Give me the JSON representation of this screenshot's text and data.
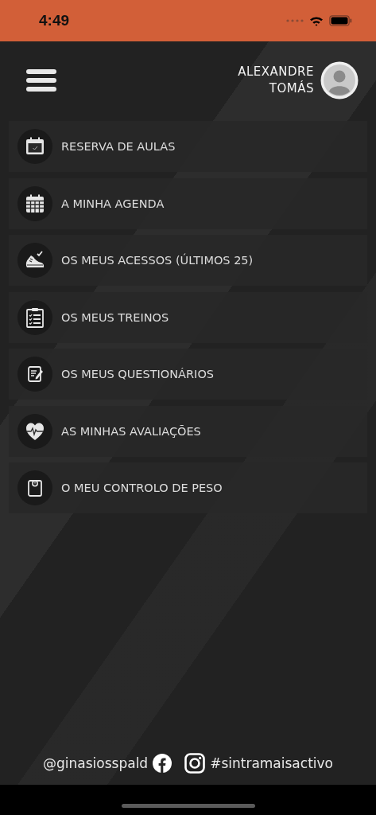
{
  "status_bar": {
    "time": "4:49"
  },
  "header": {
    "user_name": "ALEXANDRE TOMÁS"
  },
  "menu_items": [
    {
      "label": "RESERVA DE AULAS"
    },
    {
      "label": "A MINHA AGENDA"
    },
    {
      "label": "OS MEUS ACESSOS (ÚLTIMOS 25)"
    },
    {
      "label": "OS MEUS TREINOS"
    },
    {
      "label": "OS MEUS QUESTIONÁRIOS"
    },
    {
      "label": "AS MINHAS AVALIAÇÕES"
    },
    {
      "label": "O MEU CONTROLO DE PESO"
    }
  ],
  "footer": {
    "handle": "@ginasiosspald",
    "hashtag": "#sintramaisactivo"
  }
}
